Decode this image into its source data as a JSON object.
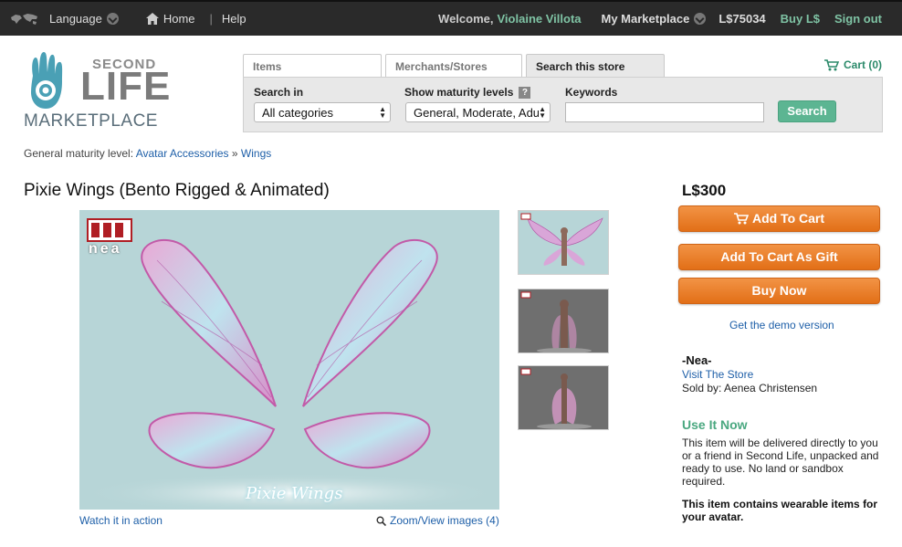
{
  "topbar": {
    "language_label": "Language",
    "home_label": "Home",
    "separator": "|",
    "help_label": "Help",
    "welcome_label": "Welcome,",
    "user_name": "Violaine Villota",
    "my_marketplace_label": "My Marketplace",
    "balance": "L$75034",
    "buy_label": "Buy L$",
    "sign_out_label": "Sign out"
  },
  "logo": {
    "second": "SECOND",
    "life": "LIFE",
    "marketplace": "MARKETPLACE"
  },
  "search": {
    "tabs": [
      {
        "label": "Items"
      },
      {
        "label": "Merchants/Stores"
      },
      {
        "label": "Search this store"
      }
    ],
    "search_in_label": "Search in",
    "search_in_value": "All categories",
    "maturity_label": "Show maturity levels",
    "maturity_help": "?",
    "maturity_value": "General, Moderate, Adult",
    "keywords_label": "Keywords",
    "keywords_value": "",
    "search_button": "Search"
  },
  "cart": {
    "label": "Cart (0)"
  },
  "breadcrumb": {
    "prefix": "General maturity level:",
    "category": "Avatar Accessories",
    "arrow": "»",
    "subcategory": "Wings"
  },
  "product": {
    "title": "Pixie Wings (Bento Rigged & Animated)",
    "image_brand": "nea",
    "image_caption": "Pixie Wings",
    "watch_label": "Watch it in action",
    "zoom_label": "Zoom/View images (4)",
    "price": "L$300",
    "add_to_cart": "Add To Cart",
    "add_as_gift": "Add To Cart As Gift",
    "buy_now": "Buy Now",
    "demo_label": "Get the demo version",
    "store_name": "-Nea-",
    "visit_store": "Visit The Store",
    "sold_by": "Sold by: Aenea Christensen",
    "use_it_now": "Use It Now",
    "delivery_text": "This item will be delivered directly to you or a friend in Second Life, unpacked and ready to use. No land or sandbox required.",
    "wearable_text": "This item contains wearable items for your avatar."
  },
  "colors": {
    "topbar_bg": "#2a2a2a",
    "accent_green": "#5cb592",
    "link_blue": "#1e5fa8",
    "orange_button": "#e8781f",
    "image_bg": "#b7d5d7"
  }
}
